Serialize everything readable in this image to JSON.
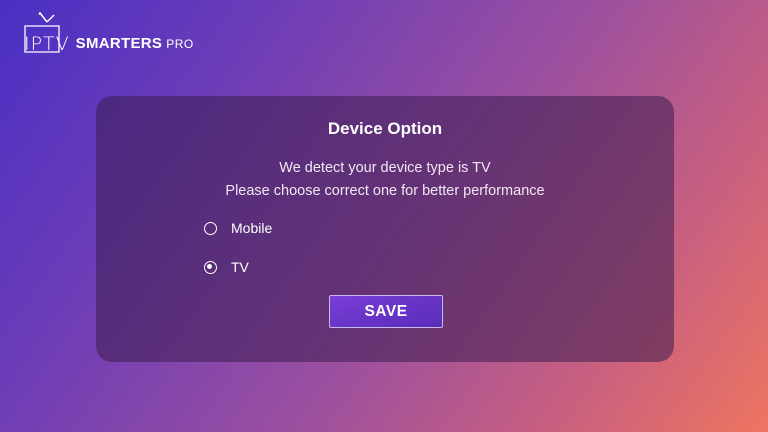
{
  "brand": {
    "iptv": "IPTV",
    "smarters": "SMARTERS",
    "pro": "PRO"
  },
  "dialog": {
    "title": "Device Option",
    "message_line1": "We detect your device type is TV",
    "message_line2": "Please choose correct one for better performance",
    "options": [
      {
        "label": "Mobile",
        "selected": false
      },
      {
        "label": "TV",
        "selected": true
      }
    ],
    "save_label": "SAVE"
  },
  "colors": {
    "accent": "#6a35c9",
    "gradient_start": "#4a2fc4",
    "gradient_end": "#ee7560"
  }
}
